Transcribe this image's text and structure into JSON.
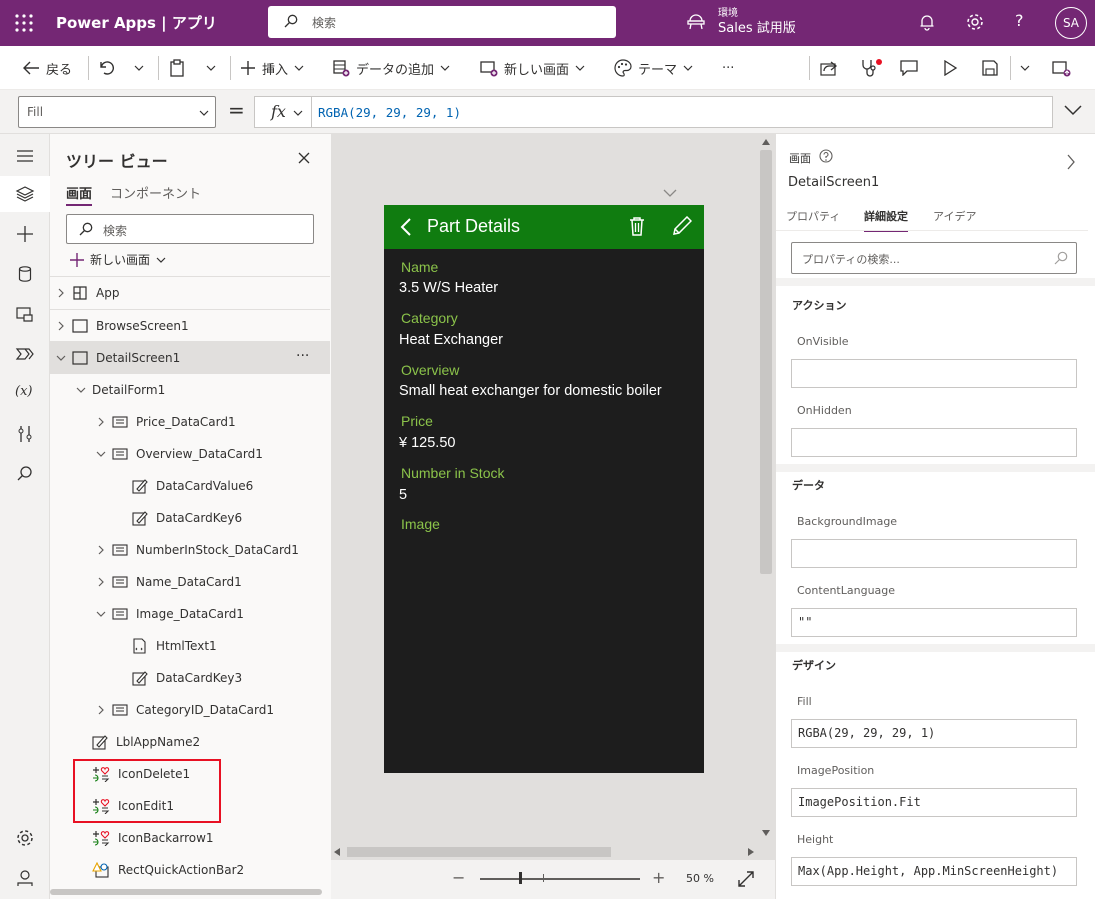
{
  "topbar": {
    "app_title": "Power Apps | アプリ",
    "search_placeholder": "検索",
    "env_label": "環境",
    "env_name": "Sales 試用版",
    "help": "?",
    "avatar": "SA"
  },
  "commands": {
    "back": "戻る",
    "insert": "挿入",
    "add_data": "データの追加",
    "new_screen": "新しい画面",
    "theme": "テーマ",
    "more": "···"
  },
  "formula_bar": {
    "property": "Fill",
    "equals": "=",
    "fx": "fx",
    "formula": "RGBA(29, 29, 29, 1)"
  },
  "tree": {
    "title": "ツリー ビュー",
    "tabs": [
      "画面",
      "コンポーネント"
    ],
    "search_placeholder": "検索",
    "new_screen": "新しい画面",
    "items": [
      {
        "label": "App"
      },
      {
        "label": "BrowseScreen1"
      },
      {
        "label": "DetailScreen1"
      },
      {
        "label": "DetailForm1"
      },
      {
        "label": "Price_DataCard1"
      },
      {
        "label": "Overview_DataCard1"
      },
      {
        "label": "DataCardValue6"
      },
      {
        "label": "DataCardKey6"
      },
      {
        "label": "NumberInStock_DataCard1"
      },
      {
        "label": "Name_DataCard1"
      },
      {
        "label": "Image_DataCard1"
      },
      {
        "label": "HtmlText1"
      },
      {
        "label": "DataCardKey3"
      },
      {
        "label": "CategoryID_DataCard1"
      },
      {
        "label": "LblAppName2"
      },
      {
        "label": "IconDelete1"
      },
      {
        "label": "IconEdit1"
      },
      {
        "label": "IconBackarrow1"
      },
      {
        "label": "RectQuickActionBar2"
      }
    ],
    "more": "···"
  },
  "phone": {
    "title": "Part Details",
    "fields": [
      {
        "label": "Name",
        "value": "3.5 W/S Heater"
      },
      {
        "label": "Category",
        "value": "Heat Exchanger"
      },
      {
        "label": "Overview",
        "value": "Small heat exchanger for domestic boiler"
      },
      {
        "label": "Price",
        "value": "¥ 125.50"
      },
      {
        "label": "Number in Stock",
        "value": "5"
      },
      {
        "label": "Image",
        "value": ""
      }
    ],
    "header_color": "#107c10",
    "fill_color": "#1d1d1d"
  },
  "zoom": {
    "minus": "−",
    "plus": "+",
    "value": "50 %"
  },
  "properties": {
    "kind": "画面",
    "name": "DetailScreen1",
    "tabs": [
      "プロパティ",
      "詳細設定",
      "アイデア"
    ],
    "search_placeholder": "プロパティの検索...",
    "sections": {
      "action": "アクション",
      "data": "データ",
      "design": "デザイン"
    },
    "fields": {
      "onvisible": {
        "label": "OnVisible",
        "value": ""
      },
      "onhidden": {
        "label": "OnHidden",
        "value": ""
      },
      "bgimage": {
        "label": "BackgroundImage",
        "value": ""
      },
      "contentlang": {
        "label": "ContentLanguage",
        "value": "\"\""
      },
      "fill": {
        "label": "Fill",
        "value": "RGBA(29, 29, 29, 1)"
      },
      "imagepos": {
        "label": "ImagePosition",
        "value": "ImagePosition.Fit"
      },
      "height": {
        "label": "Height",
        "value": "Max(App.Height, App.MinScreenHeight)"
      }
    }
  },
  "colors": {
    "brand": "#742774",
    "highlight": "#e81123"
  }
}
